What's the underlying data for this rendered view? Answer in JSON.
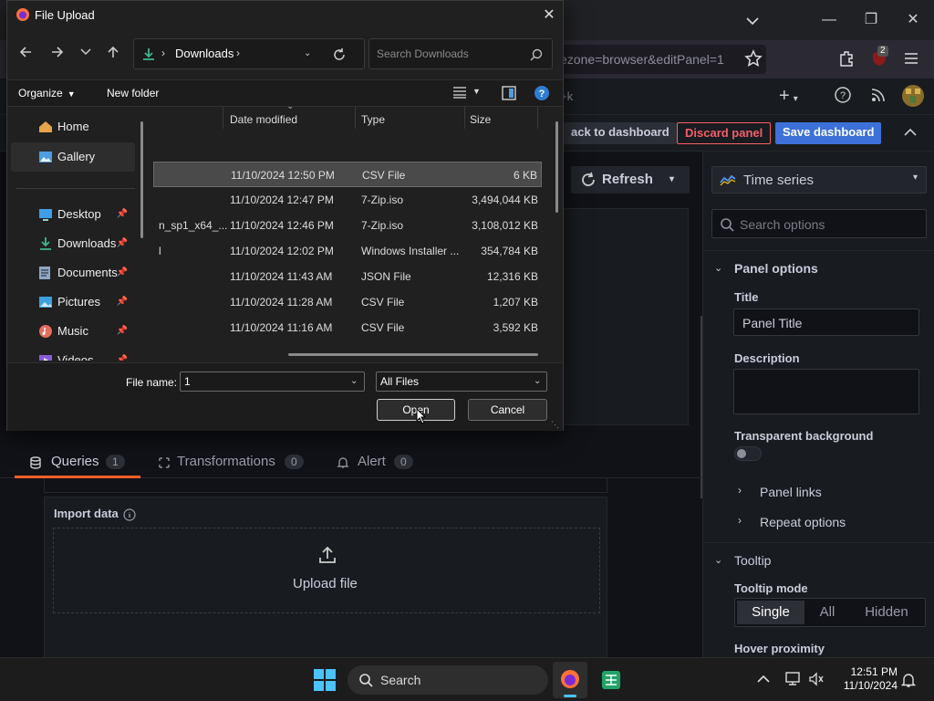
{
  "browser": {
    "url_text": "ezone=browser&editPanel=1",
    "badge_count": "2",
    "new_tab_shortcut": "+k"
  },
  "grafana": {
    "back_label": "ack to dashboard",
    "discard_label": "Discard panel",
    "save_label": "Save dashboard",
    "refresh_label": "Refresh",
    "tabs": [
      {
        "label": "Queries",
        "count": "1"
      },
      {
        "label": "Transformations",
        "count": "0"
      },
      {
        "label": "Alert",
        "count": "0"
      }
    ],
    "import_title": "Import data",
    "upload_label": "Upload file",
    "viz_picker": "Time series",
    "search_options_placeholder": "Search options",
    "panel_options": "Panel options",
    "title_label": "Title",
    "title_value": "Panel Title",
    "description_label": "Description",
    "transparent_label": "Transparent background",
    "panel_links": "Panel links",
    "repeat_options": "Repeat options",
    "tooltip_section": "Tooltip",
    "tooltip_mode_label": "Tooltip mode",
    "tooltip_modes": [
      "Single",
      "All",
      "Hidden"
    ],
    "hover_proximity": "Hover proximity"
  },
  "dialog": {
    "title": "File Upload",
    "breadcrumb": "Downloads",
    "search_placeholder": "Search Downloads",
    "organize": "Organize",
    "new_folder": "New folder",
    "columns": [
      "Date modified",
      "Type",
      "Size"
    ],
    "nav": [
      {
        "label": "Home"
      },
      {
        "label": "Gallery"
      },
      {
        "label": "Desktop"
      },
      {
        "label": "Downloads"
      },
      {
        "label": "Documents"
      },
      {
        "label": "Pictures"
      },
      {
        "label": "Music"
      },
      {
        "label": "Videos"
      }
    ],
    "files": [
      {
        "name": "",
        "date": "11/10/2024 12:50 PM",
        "type": "CSV File",
        "size": "6 KB"
      },
      {
        "name": "",
        "date": "11/10/2024 12:47 PM",
        "type": "7-Zip.iso",
        "size": "3,494,044 KB"
      },
      {
        "name": "n_sp1_x64_...",
        "date": "11/10/2024 12:46 PM",
        "type": "7-Zip.iso",
        "size": "3,108,012 KB"
      },
      {
        "name": "l",
        "date": "11/10/2024 12:02 PM",
        "type": "Windows Installer ...",
        "size": "354,784 KB"
      },
      {
        "name": "",
        "date": "11/10/2024 11:43 AM",
        "type": "JSON File",
        "size": "12,316 KB"
      },
      {
        "name": "",
        "date": "11/10/2024 11:28 AM",
        "type": "CSV File",
        "size": "1,207 KB"
      },
      {
        "name": "",
        "date": "11/10/2024 11:16 AM",
        "type": "CSV File",
        "size": "3,592 KB"
      }
    ],
    "filename_label": "File name:",
    "filename_value": "1",
    "filetype_value": "All Files",
    "open_label": "Open",
    "cancel_label": "Cancel"
  },
  "taskbar": {
    "search_label": "Search",
    "time": "12:51 PM",
    "date": "11/10/2024"
  },
  "colors": {
    "accent_blue": "#3d71d9",
    "discard_red": "#f55f6a",
    "dialog_bg": "#202020",
    "grafana_bg": "#111217"
  }
}
